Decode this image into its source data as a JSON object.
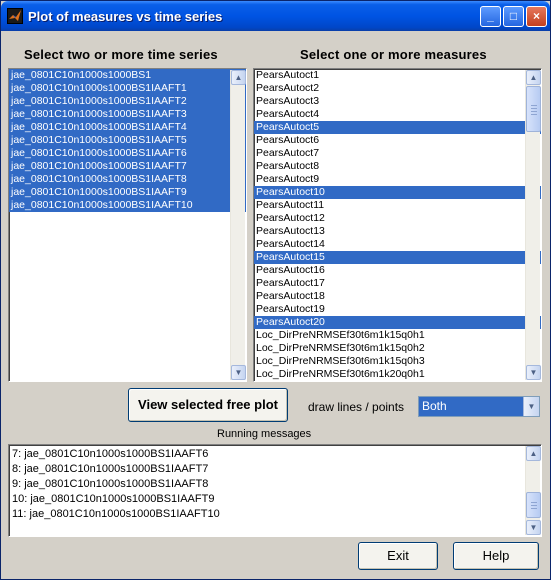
{
  "window": {
    "title": "Plot of measures vs time series",
    "minimize_glyph": "_",
    "maximize_glyph": "□",
    "close_glyph": "×"
  },
  "left_panel": {
    "heading": "Select two or more time series",
    "items": [
      {
        "label": "jae_0801C10n1000s1000BS1",
        "selected": true
      },
      {
        "label": "jae_0801C10n1000s1000BS1IAAFT1",
        "selected": true
      },
      {
        "label": "jae_0801C10n1000s1000BS1IAAFT2",
        "selected": true
      },
      {
        "label": "jae_0801C10n1000s1000BS1IAAFT3",
        "selected": true
      },
      {
        "label": "jae_0801C10n1000s1000BS1IAAFT4",
        "selected": true
      },
      {
        "label": "jae_0801C10n1000s1000BS1IAAFT5",
        "selected": true
      },
      {
        "label": "jae_0801C10n1000s1000BS1IAAFT6",
        "selected": true
      },
      {
        "label": "jae_0801C10n1000s1000BS1IAAFT7",
        "selected": true
      },
      {
        "label": "jae_0801C10n1000s1000BS1IAAFT8",
        "selected": true
      },
      {
        "label": "jae_0801C10n1000s1000BS1IAAFT9",
        "selected": true
      },
      {
        "label": "jae_0801C10n1000s1000BS1IAAFT10",
        "selected": true
      }
    ]
  },
  "right_panel": {
    "heading": "Select one or more measures",
    "items": [
      {
        "label": "PearsAutoct1",
        "selected": false
      },
      {
        "label": "PearsAutoct2",
        "selected": false
      },
      {
        "label": "PearsAutoct3",
        "selected": false
      },
      {
        "label": "PearsAutoct4",
        "selected": false
      },
      {
        "label": "PearsAutoct5",
        "selected": true
      },
      {
        "label": "PearsAutoct6",
        "selected": false
      },
      {
        "label": "PearsAutoct7",
        "selected": false
      },
      {
        "label": "PearsAutoct8",
        "selected": false
      },
      {
        "label": "PearsAutoct9",
        "selected": false
      },
      {
        "label": "PearsAutoct10",
        "selected": true
      },
      {
        "label": "PearsAutoct11",
        "selected": false
      },
      {
        "label": "PearsAutoct12",
        "selected": false
      },
      {
        "label": "PearsAutoct13",
        "selected": false
      },
      {
        "label": "PearsAutoct14",
        "selected": false
      },
      {
        "label": "PearsAutoct15",
        "selected": true
      },
      {
        "label": "PearsAutoct16",
        "selected": false
      },
      {
        "label": "PearsAutoct17",
        "selected": false
      },
      {
        "label": "PearsAutoct18",
        "selected": false
      },
      {
        "label": "PearsAutoct19",
        "selected": false
      },
      {
        "label": "PearsAutoct20",
        "selected": true
      },
      {
        "label": "Loc_DirPreNRMSEf30t6m1k15q0h1",
        "selected": false
      },
      {
        "label": "Loc_DirPreNRMSEf30t6m1k15q0h2",
        "selected": false
      },
      {
        "label": "Loc_DirPreNRMSEf30t6m1k15q0h3",
        "selected": false
      },
      {
        "label": "Loc_DirPreNRMSEf30t6m1k20q0h1",
        "selected": false
      }
    ]
  },
  "controls": {
    "view_button": "View selected free plot",
    "draw_label": "draw lines / points",
    "draw_value": "Both"
  },
  "messages": {
    "heading": "Running messages",
    "lines": [
      "7: jae_0801C10n1000s1000BS1IAAFT6",
      "8: jae_0801C10n1000s1000BS1IAAFT7",
      "9: jae_0801C10n1000s1000BS1IAAFT8",
      "10: jae_0801C10n1000s1000BS1IAAFT9",
      "11: jae_0801C10n1000s1000BS1IAAFT10"
    ]
  },
  "footer": {
    "exit_label": "Exit",
    "help_label": "Help"
  },
  "colors": {
    "selection": "#316ac5",
    "window_face": "#d4d0c8",
    "titlebar": "#0054e3"
  },
  "icons": {
    "app": "matlab-icon",
    "arrow_up": "▲",
    "arrow_down": "▼"
  }
}
